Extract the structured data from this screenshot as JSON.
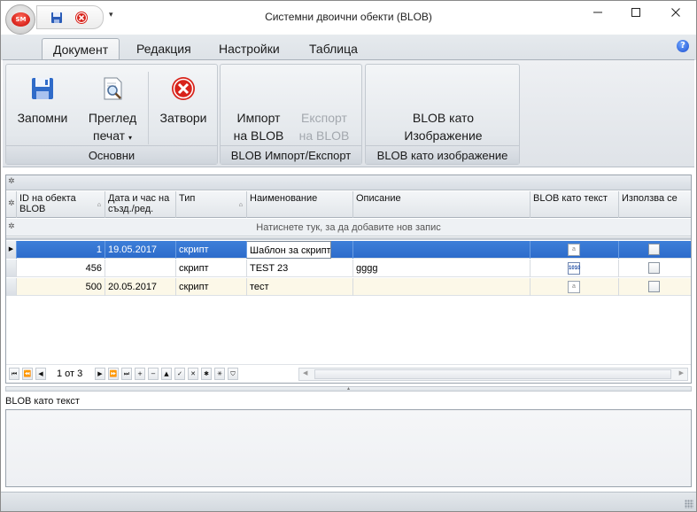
{
  "window": {
    "title": "Системни двоични обекти (BLOB)",
    "app_badge": "SM"
  },
  "ribbon": {
    "tabs": [
      {
        "label": "Документ",
        "active": true
      },
      {
        "label": "Редакция"
      },
      {
        "label": "Настройки"
      },
      {
        "label": "Таблица"
      }
    ],
    "groups": {
      "basic": {
        "label": "Основни",
        "save_l1": "Запомни",
        "preview_l1": "Преглед",
        "preview_l2": "печат",
        "close_l1": "Затвори"
      },
      "blob_io": {
        "label": "BLOB Импорт/Експорт",
        "import_l1": "Импорт",
        "import_l2": "на BLOB",
        "export_l1": "Експорт",
        "export_l2": "на BLOB"
      },
      "blob_image": {
        "label": "BLOB като изображение",
        "btn_l1": "BLOB като",
        "btn_l2": "Изображение"
      }
    }
  },
  "grid": {
    "columns": [
      {
        "l1": "ID на обекта",
        "l2": "BLOB"
      },
      {
        "l1": "Дата и час на",
        "l2": "създ./ред."
      },
      {
        "l1": "Тип",
        "l2": ""
      },
      {
        "l1": "Наименование",
        "l2": ""
      },
      {
        "l1": "Описание",
        "l2": ""
      },
      {
        "l1": "BLOB като текст",
        "l2": ""
      },
      {
        "l1": "Използва се",
        "l2": ""
      }
    ],
    "new_row_prompt": "Натиснете тук, за да добавите нов запис",
    "rows": [
      {
        "id": "1",
        "date": "19.05.2017",
        "type": "скрипт",
        "name": "Шаблон за скрипт",
        "desc": "",
        "blob_icon": "text",
        "used": false
      },
      {
        "id": "456",
        "date": "",
        "type": "скрипт",
        "name": "TEST 23",
        "desc": "gggg",
        "blob_icon": "binary",
        "used": false
      },
      {
        "id": "500",
        "date": "20.05.2017",
        "type": "скрипт",
        "name": "тест",
        "desc": "",
        "blob_icon": "text",
        "used": false
      }
    ],
    "navigator_text": "1 от 3"
  },
  "detail": {
    "label": "BLOB като текст"
  },
  "colors": {
    "selection": "#2d6ccb",
    "alt_row": "#fcf8e8",
    "close_red": "#d8231b"
  }
}
